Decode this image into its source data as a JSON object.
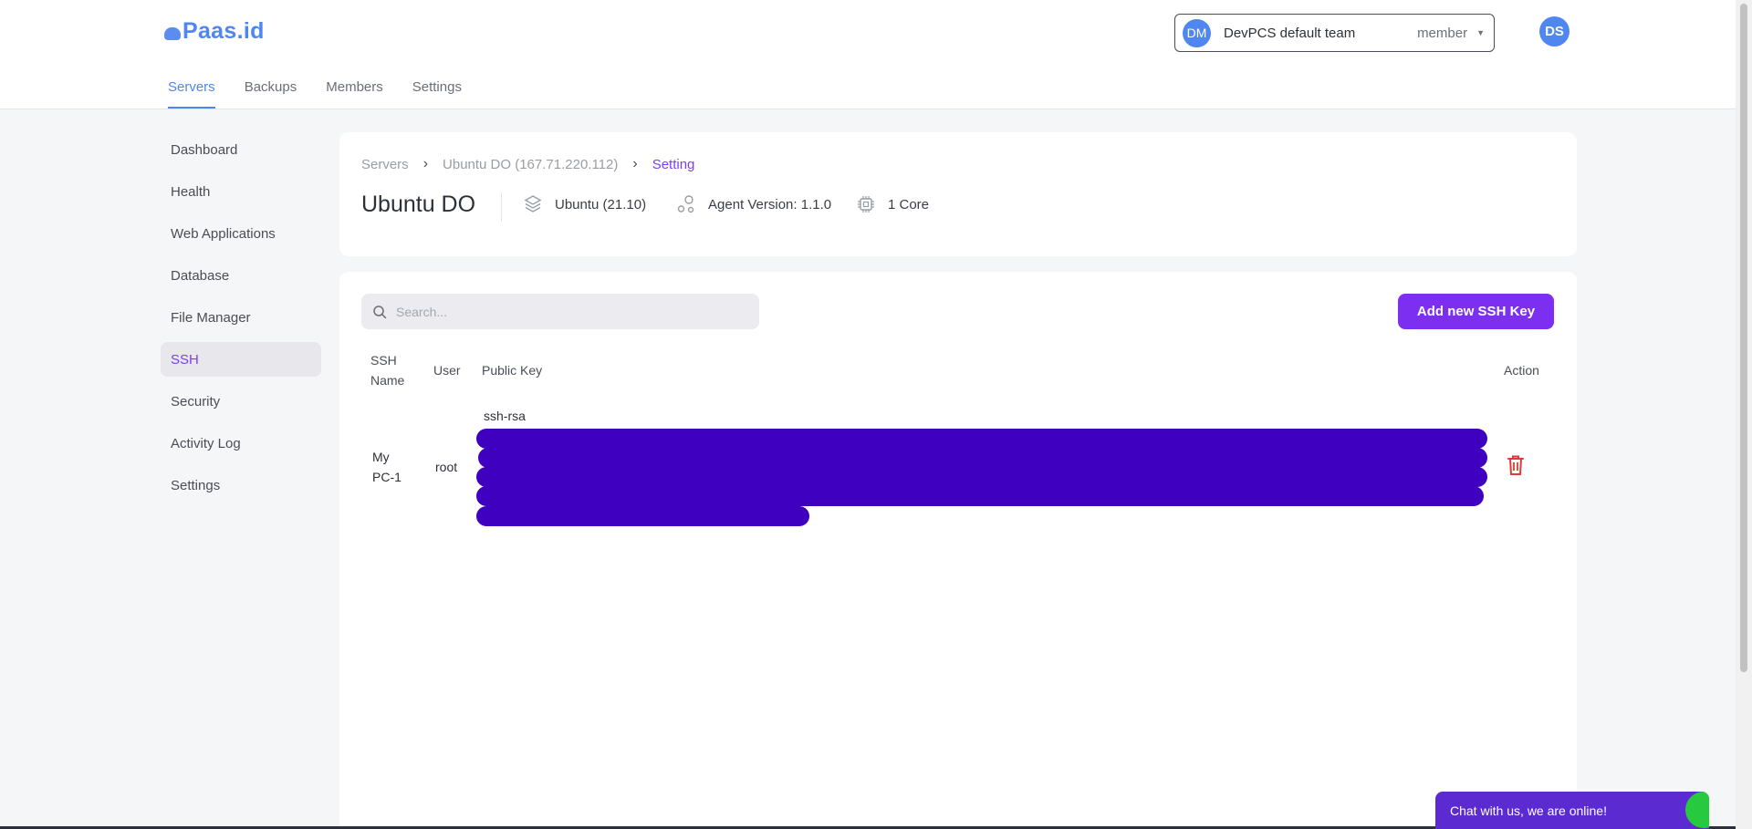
{
  "brand": {
    "name": "Paas.id"
  },
  "team": {
    "initials": "DM",
    "name": "DevPCS default team",
    "role": "member"
  },
  "user": {
    "initials": "DS"
  },
  "main_tabs": [
    {
      "label": "Servers",
      "active": true
    },
    {
      "label": "Backups"
    },
    {
      "label": "Members"
    },
    {
      "label": "Settings"
    }
  ],
  "sidebar": {
    "items": [
      {
        "label": "Dashboard"
      },
      {
        "label": "Health"
      },
      {
        "label": "Web Applications"
      },
      {
        "label": "Database"
      },
      {
        "label": "File Manager"
      },
      {
        "label": "SSH",
        "active": true
      },
      {
        "label": "Security"
      },
      {
        "label": "Activity Log"
      },
      {
        "label": "Settings"
      }
    ]
  },
  "breadcrumb": {
    "root": "Servers",
    "server": "Ubuntu DO (167.71.220.112)",
    "current": "Setting"
  },
  "server": {
    "name": "Ubuntu DO",
    "os": "Ubuntu (21.10)",
    "agent": "Agent Version: 1.1.0",
    "cores": "1 Core"
  },
  "search": {
    "placeholder": "Search..."
  },
  "buttons": {
    "add_ssh_key": "Add new SSH Key"
  },
  "table": {
    "headers": {
      "ssh_name_1": "SSH",
      "ssh_name_2": "Name",
      "user": "User",
      "public_key": "Public Key",
      "action": "Action"
    },
    "rows": [
      {
        "name_1": "My",
        "name_2": "PC-1",
        "user": "root",
        "key_prefix": "ssh-rsa"
      }
    ]
  },
  "chat": {
    "label": "Chat with us, we are online!"
  },
  "colors": {
    "accent": "#7c2ff0",
    "primary_blue": "#4f86f0",
    "redaction": "#3f00bf",
    "delete": "#e53935"
  }
}
